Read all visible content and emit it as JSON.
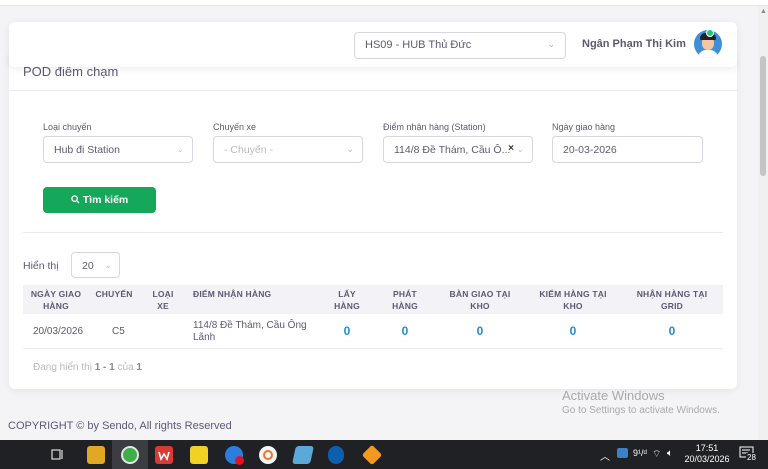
{
  "header": {
    "hub_value": "HS09 - HUB Thủ Đức",
    "user_name": "Ngân Phạm Thị Kim"
  },
  "page": {
    "title": "POD điểm chạm"
  },
  "filters": {
    "trip_type": {
      "label": "Loại chuyến",
      "value": "Hub đi Station"
    },
    "vehicle_trip": {
      "label": "Chuyến xe",
      "placeholder": "- Chuyến -"
    },
    "station": {
      "label": "Điểm nhận hàng (Station)",
      "value": "114/8 Đề Thám, Cầu Ô..."
    },
    "delivery_date": {
      "label": "Ngày giao hàng",
      "value": "20-03-2026"
    },
    "search_label": "Tìm kiếm"
  },
  "table": {
    "show_label": "Hiển thị",
    "page_size": "20",
    "columns": [
      "NGÀY GIAO HÀNG",
      "CHUYẾN",
      "LOẠI XE",
      "ĐIỂM NHẬN HÀNG",
      "LẤY HÀNG",
      "PHÁT HÀNG",
      "BÀN GIAO TẠI KHO",
      "KIỂM HÀNG TẠI KHO",
      "NHẬN HÀNG TẠI GRID"
    ],
    "rows": [
      {
        "date": "20/03/2026",
        "trip": "C5",
        "vehicle_type": "",
        "station": "114/8 Đề Thám, Cầu Ông Lãnh",
        "pickup": "0",
        "delivery": "0",
        "handover": "0",
        "inspect": "0",
        "grid_receive": "0"
      }
    ],
    "pager": {
      "prefix": "Đang hiển thị ",
      "range": "1 - 1",
      "of": " của ",
      "total": "1"
    }
  },
  "footer": {
    "copyright": "COPYRIGHT © by Sendo, All rights Reserved"
  },
  "watermark": {
    "line1": "Activate Windows",
    "line2": "Go to Settings to activate Windows."
  },
  "taskbar": {
    "time": "17:51",
    "date": "20/03/2026",
    "notifications": "28",
    "lang": "9¹/ᵈ"
  }
}
